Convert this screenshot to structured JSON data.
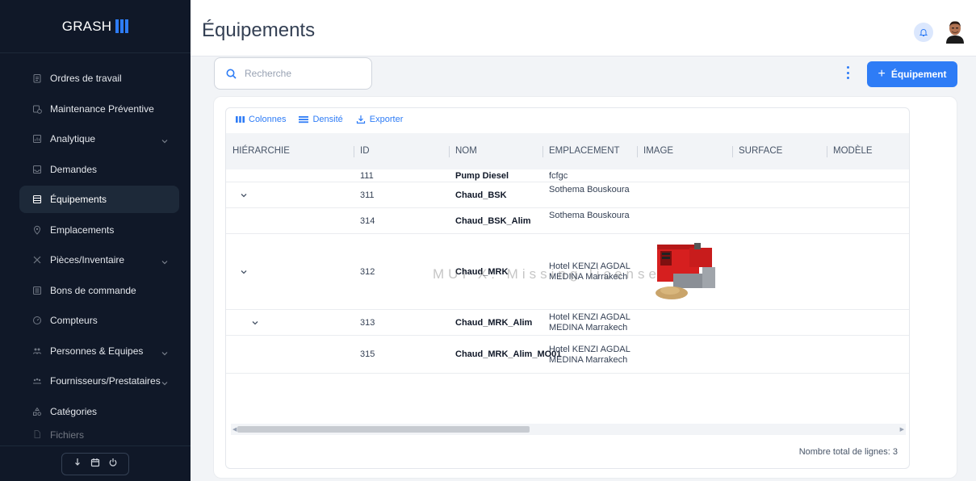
{
  "brand": {
    "name": "GRASH"
  },
  "sidebar": {
    "items": [
      {
        "label": "Ordres de travail",
        "icon": "clipboard-icon",
        "chevron": false
      },
      {
        "label": "Maintenance Préventive",
        "icon": "calendar-clock-icon",
        "chevron": false
      },
      {
        "label": "Analytique",
        "icon": "chart-icon",
        "chevron": true
      },
      {
        "label": "Demandes",
        "icon": "inbox-icon",
        "chevron": false
      },
      {
        "label": "Équipements",
        "icon": "archive-icon",
        "chevron": false,
        "active": true
      },
      {
        "label": "Emplacements",
        "icon": "location-pin-icon",
        "chevron": false
      },
      {
        "label": "Pièces/Inventaire",
        "icon": "tools-icon",
        "chevron": true
      },
      {
        "label": "Bons de commande",
        "icon": "list-icon",
        "chevron": false
      },
      {
        "label": "Compteurs",
        "icon": "gauge-icon",
        "chevron": false
      },
      {
        "label": "Personnes & Equipes",
        "icon": "people-icon",
        "chevron": true
      },
      {
        "label": "Fournisseurs/Prestataires",
        "icon": "people-group-icon",
        "chevron": true
      },
      {
        "label": "Catégories",
        "icon": "categories-icon",
        "chevron": false
      },
      {
        "label": "Fichiers",
        "icon": "file-icon",
        "chevron": false
      }
    ]
  },
  "header": {
    "title": "Équipements"
  },
  "toolbar": {
    "search_placeholder": "Recherche",
    "add_label": "Équipement"
  },
  "grid": {
    "tools": {
      "columns": "Colonnes",
      "density": "Densité",
      "export": "Exporter"
    },
    "columns": [
      "HIÉRARCHIE",
      "ID",
      "NOM",
      "EMPLACEMENT",
      "IMAGE",
      "SURFACE",
      "MODÈLE"
    ],
    "rows": [
      {
        "id": "111",
        "name": "Pump Diesel",
        "location": "fcfgc",
        "expandable": false,
        "has_image": false
      },
      {
        "id": "311",
        "name": "Chaud_BSK",
        "location": "Sothema Bouskoura",
        "expandable": true,
        "has_image": false
      },
      {
        "id": "314",
        "name": "Chaud_BSK_Alim",
        "location": "Sothema Bouskoura",
        "expandable": false,
        "has_image": false
      },
      {
        "id": "312",
        "name": "Chaud_MRK",
        "location": "Hotel KENZI AGDAL MEDINA Marrakech",
        "expandable": true,
        "has_image": true
      },
      {
        "id": "313",
        "name": "Chaud_MRK_Alim",
        "location": "Hotel KENZI AGDAL MEDINA Marrakech",
        "expandable": true,
        "has_image": false
      },
      {
        "id": "315",
        "name": "Chaud_MRK_Alim_MO01",
        "location": "Hotel KENZI AGDAL MEDINA Marrakech",
        "expandable": false,
        "has_image": false
      }
    ],
    "footer": "Nombre total de lignes: 3"
  },
  "watermark": "MUI X: Missing license",
  "colors": {
    "sidebar_bg": "#101828",
    "accent": "#2e7cf6",
    "page_bg": "#f2f4f7"
  }
}
